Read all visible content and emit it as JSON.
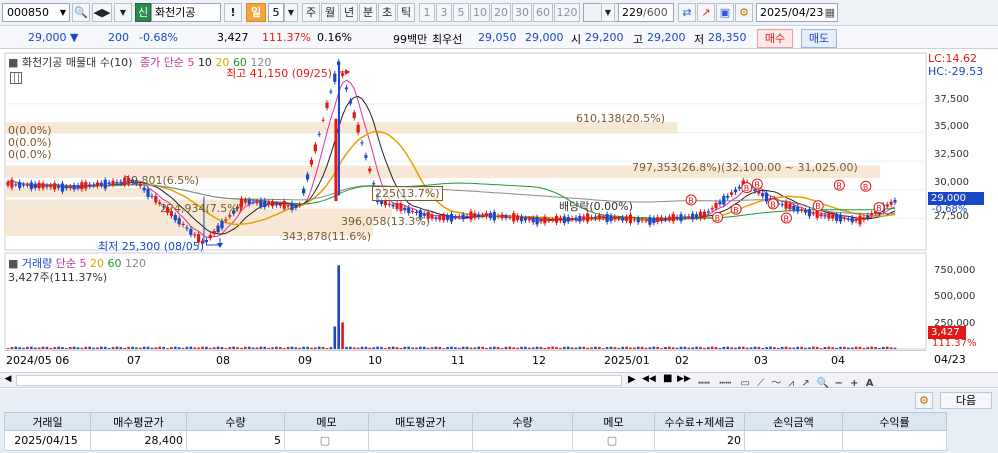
{
  "toolbar": {
    "code": "000850",
    "badge": "신",
    "name": "화천기공",
    "alert": "!",
    "period_active": "일",
    "period_value": "5",
    "periods": [
      "주",
      "월",
      "년",
      "분",
      "초",
      "틱"
    ],
    "intervals": [
      "1",
      "3",
      "5",
      "10",
      "20",
      "30",
      "60",
      "120"
    ],
    "count": "229",
    "count_total": "/600",
    "date": "2025/04/23"
  },
  "price": {
    "last": "29,000",
    "dir": "▼",
    "change": "200",
    "rate": "-0.68%",
    "volume": "3,427",
    "vol_ratio": "111.37%",
    "turnover": "0.16%",
    "unit": "99백만",
    "best_ask_label": "최우선",
    "best_ask": "29,050",
    "best_bid": "29,000",
    "open_label": "시",
    "open": "29,200",
    "high_label": "고",
    "high": "29,200",
    "low_label": "저",
    "low": "28,350",
    "buy": "매수",
    "sell": "매도"
  },
  "chart_labels": {
    "title": "화천기공 매물대 수(10)",
    "ma_label": "종가 단순",
    "ma_periods": [
      "5",
      "10",
      "20",
      "60",
      "120"
    ],
    "ma_colors": [
      "#e0309a",
      "#222222",
      "#e8a000",
      "#1a9a2a",
      "#888888"
    ],
    "lc": "LC:14.62",
    "hc": "HC:-29.53",
    "high_note": "최고 41,150 (09/25)",
    "low_note": "최저 25,300 (08/05)",
    "dividend": "배당락(0.00%)",
    "vp_labels": [
      "610,138(20.5%)",
      "797,353(26.8%)(32,100.00 ~ 31,025.00)",
      "10,801(6.5%)",
      "224,934(7.5%)",
      "396,058(13.3%)",
      "343,878(11.6%)",
      "0(0.0%)",
      "0(0.0%)",
      "0(0.0%)",
      "225(13.7%)"
    ],
    "vol_title": "거래량",
    "vol_ma": "단순",
    "vol_periods": [
      "5",
      "20",
      "60",
      "120"
    ],
    "vol_now": "3,427주(111.37%)",
    "price_axis": [
      "37,500",
      "35,000",
      "32,500",
      "30,000",
      "27,500"
    ],
    "vol_axis": [
      "750,000",
      "500,000",
      "250,000"
    ],
    "current_tag": "29,000",
    "current_rate": "-0.68%",
    "vol_tag": "3,427",
    "vol_rate": "111.37%",
    "x_axis": [
      "2024/05 06",
      "07",
      "08",
      "09",
      "10",
      "11",
      "12",
      "2025/01",
      "02",
      "03",
      "04"
    ],
    "last_date": "04/23"
  },
  "chart_data": {
    "type": "line",
    "x": [
      "2024-05-23",
      "2024-06-15",
      "2024-07-10",
      "2024-08-05",
      "2024-08-20",
      "2024-09-10",
      "2024-09-25",
      "2024-10-10",
      "2024-11-01",
      "2024-11-20",
      "2024-12-10",
      "2025-01-02",
      "2025-01-20",
      "2025-02-10",
      "2025-02-25",
      "2025-03-10",
      "2025-03-25",
      "2025-04-10",
      "2025-04-23"
    ],
    "series": [
      {
        "values": [
          30500,
          30200,
          30800,
          25300,
          29000,
          28500,
          41150,
          29000,
          27500,
          27800,
          27300,
          27600,
          27300,
          27800,
          30500,
          28800,
          27800,
          27300,
          29000
        ]
      }
    ],
    "ylim": [
      25000,
      41500
    ],
    "volume_ylim": [
      0,
      800000
    ]
  },
  "scroll": {
    "icons": [
      "▶",
      "◀◀",
      "■",
      "▶▶"
    ]
  },
  "bottom": {
    "next": "다음",
    "headers": [
      "거래일",
      "매수평균가",
      "수량",
      "메모",
      "매도평균가",
      "수량",
      "메모",
      "수수료+제세금",
      "손익금액",
      "수익률"
    ],
    "row": [
      "2025/04/15",
      "28,400",
      "5",
      "",
      "",
      "",
      "",
      "20",
      "",
      ""
    ]
  }
}
